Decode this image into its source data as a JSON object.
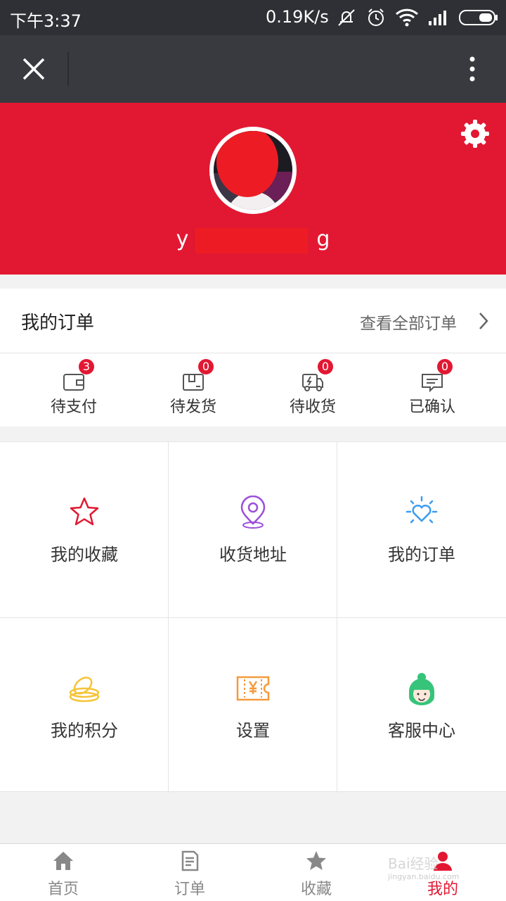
{
  "status_bar": {
    "time": "下午3:37",
    "network_speed": "0.19K/s",
    "icons": [
      "mute-icon",
      "alarm-icon",
      "wifi-icon",
      "signal-icon",
      "battery-icon"
    ]
  },
  "title_bar": {
    "close_icon": "close-icon",
    "more_icon": "more-vertical-icon"
  },
  "profile": {
    "username_start": "y",
    "username_end": "g",
    "settings_icon": "gear-icon",
    "background_color": "#e21832"
  },
  "orders": {
    "title": "我的订单",
    "view_all": "查看全部订单",
    "statuses": [
      {
        "label": "待支付",
        "count": "3",
        "icon": "wallet-icon"
      },
      {
        "label": "待发货",
        "count": "0",
        "icon": "package-icon"
      },
      {
        "label": "待收货",
        "count": "0",
        "icon": "truck-icon"
      },
      {
        "label": "已确认",
        "count": "0",
        "icon": "message-check-icon"
      }
    ]
  },
  "grid": [
    {
      "label": "我的收藏",
      "icon": "star-icon",
      "color": "#e21832"
    },
    {
      "label": "收货地址",
      "icon": "location-pin-icon",
      "color": "#9b4fd9"
    },
    {
      "label": "我的订单",
      "icon": "sun-heart-icon",
      "color": "#3b9cf0"
    },
    {
      "label": "我的积分",
      "icon": "coins-icon",
      "color": "#f5c437"
    },
    {
      "label": "设置",
      "icon": "ticket-yen-icon",
      "color": "#f59a3c"
    },
    {
      "label": "客服中心",
      "icon": "customer-service-icon",
      "color": "#36c47a"
    }
  ],
  "tabbar": {
    "tabs": [
      {
        "label": "首页",
        "icon": "home-icon"
      },
      {
        "label": "订单",
        "icon": "document-icon"
      },
      {
        "label": "收藏",
        "icon": "star-icon"
      },
      {
        "label": "我的",
        "icon": "user-icon"
      }
    ],
    "active_index": 3,
    "watermark": "Bai经验",
    "watermark_sub": "jingyan.baidu.com"
  }
}
